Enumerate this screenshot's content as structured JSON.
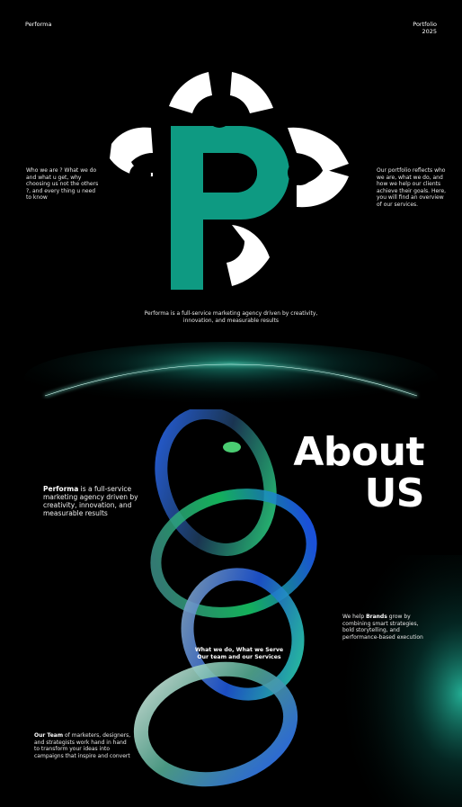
{
  "header": {
    "brand": "Performa",
    "portfolio": "Portfolio",
    "year": "2025"
  },
  "hero": {
    "who_text": "Who we are ? What we do and what u get, why choosing us not the others ?, and every thing u need to know",
    "portfolio_text": "Our portfolio reflects who we are, what we do, and how we help our clients achieve their goals. Here, you will find an overview of our services.",
    "tagline": "Performa is a full-service marketing agency driven by creativity, innovation, and measurable results"
  },
  "about": {
    "title_line1": "About",
    "title_line2": "US",
    "perf_bold": "Performa",
    "perf_text": " is a full-service marketing agency driven by creativity, innovation, and measurable results",
    "brands_pre": "We help ",
    "brands_bold": "Brands",
    "brands_text": " grow by combining smart strategies, bold storytelling, and performance-based execution",
    "serve_line1": "What we do, What we Serve",
    "serve_line2": "Our team and our Services",
    "team_bold": "Our Team",
    "team_text": " of marketers, designers, and strategists work hand in hand to transform your ideas into campaigns that inspire and convert"
  },
  "colors": {
    "background": "#000000",
    "logo_green": "#0e9a82",
    "logo_white": "#ffffff",
    "accent_glow": "#2ee6c4"
  },
  "icons": {
    "logo": "performa-p-logo-icon",
    "rings": "chain-rings-icon"
  }
}
